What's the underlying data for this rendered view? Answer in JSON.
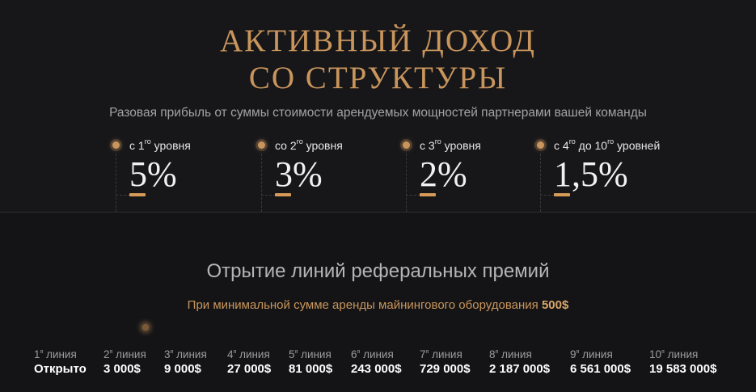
{
  "header": {
    "title_line1": "АКТИВНЫЙ ДОХОД",
    "title_line2": "СО СТРУКТУРЫ",
    "subtitle": "Разовая прибыль от суммы стоимости арендуемых мощностей партнерами вашей команды"
  },
  "levels": [
    {
      "prefix": "с 1",
      "sup": "го",
      "suffix": " уровня",
      "suffix2": "",
      "sup2": "",
      "percent": "5%"
    },
    {
      "prefix": "со 2",
      "sup": "го",
      "suffix": " уровня",
      "suffix2": "",
      "sup2": "",
      "percent": "3%"
    },
    {
      "prefix": "с 3",
      "sup": "го",
      "suffix": " уровня",
      "suffix2": "",
      "sup2": "",
      "percent": "2%"
    },
    {
      "prefix": "с 4",
      "sup": "го",
      "suffix": " до 10",
      "sup2": "го",
      "suffix2": " уровней",
      "percent": "1,5%"
    }
  ],
  "referral": {
    "title": "Отрытие линий реферальных премий",
    "note_text": "При минимальной сумме аренды майнингового оборудования ",
    "note_amount": "500$",
    "lines": [
      {
        "num": "1",
        "sup": "я",
        "word": " линия",
        "value": "Открыто"
      },
      {
        "num": "2",
        "sup": "я",
        "word": " линия",
        "value": "3 000$"
      },
      {
        "num": "3",
        "sup": "я",
        "word": " линия",
        "value": "9 000$"
      },
      {
        "num": "4",
        "sup": "я",
        "word": " линия",
        "value": "27 000$"
      },
      {
        "num": "5",
        "sup": "я",
        "word": " линия",
        "value": "81 000$"
      },
      {
        "num": "6",
        "sup": "я",
        "word": " линия",
        "value": "243 000$"
      },
      {
        "num": "7",
        "sup": "я",
        "word": " линия",
        "value": "729 000$"
      },
      {
        "num": "8",
        "sup": "я",
        "word": " линия",
        "value": "2 187 000$"
      },
      {
        "num": "9",
        "sup": "я",
        "word": " линия",
        "value": "6 561 000$"
      },
      {
        "num": "10",
        "sup": "я",
        "word": " линия",
        "value": "19 583 000$"
      }
    ]
  },
  "colors": {
    "accent": "#c8955c",
    "background": "#141416",
    "text": "#ffffff"
  }
}
